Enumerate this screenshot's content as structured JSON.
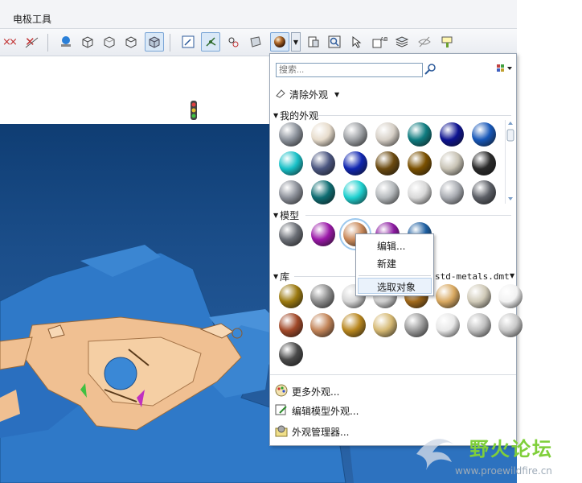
{
  "menubar": {
    "item": "电极工具"
  },
  "toolbar": {
    "buttons": [
      "points-x-icon",
      "points-x2-icon",
      "sphere-view-icon",
      "cube-wire-icon",
      "cube-hidden-icon",
      "cube-no-hidden-icon",
      "cube-shaded-icon",
      "sketch-view-icon",
      "datum-tree-icon",
      "spin-center-icon",
      "saved-views-icon",
      "appearance-ball-icon",
      "appearance-dropdown",
      "display-style-icon",
      "zoom-window-icon",
      "select-tool-icon",
      "annotation-icon",
      "layers-icon",
      "hide-icon",
      "filter-icon"
    ]
  },
  "panel": {
    "search_placeholder": "搜索...",
    "clear_label": "清除外观",
    "sections": {
      "my": "我的外观",
      "model": "模型",
      "library": "库"
    },
    "library_file": "std-metals.dmt",
    "my_spheres": [
      [
        "#8c929b",
        "#e7dccc",
        "#9da0a4",
        "#d7d0c7",
        "#0f7c80",
        "#0d1290",
        "#1757b8"
      ],
      [
        "#18c0c7",
        "#4b5680",
        "#1026b0",
        "#6b4a10",
        "#7a5000",
        "#c8c3b5",
        "#2a2a2a"
      ],
      [
        "#8c9099",
        "#0e6d72",
        "#1fd0cf",
        "#b5b9bc",
        "#d8d8d8",
        "#a9acb2",
        "#5c5f66"
      ]
    ],
    "model_spheres": [
      "#6a6e75",
      "#9a18a8",
      "#c9895a",
      "#8b1aa0",
      "#1d5ea0"
    ],
    "library_spheres": [
      [
        "#9c7a10",
        "#8c8c8c",
        "#d5d5d5",
        "#cccccc",
        "#a0681a",
        "#d8a860",
        "#d0cab8",
        "#f2f2f2"
      ],
      [
        "#a04828",
        "#c28458",
        "#b8861e",
        "#d5b872",
        "#9a9a9a",
        "#e8e8e8",
        "#bfbfbf",
        "#c8c8c8"
      ],
      [
        "#4a4a4a"
      ]
    ],
    "footer": {
      "more": "更多外观...",
      "edit_model": "编辑模型外观...",
      "manager": "外观管理器..."
    }
  },
  "context_menu": {
    "edit": "编辑...",
    "new": "新建",
    "select_object": "选取对象"
  },
  "watermark": {
    "title": "野火论坛",
    "url": "www.proewildfire.cn"
  }
}
